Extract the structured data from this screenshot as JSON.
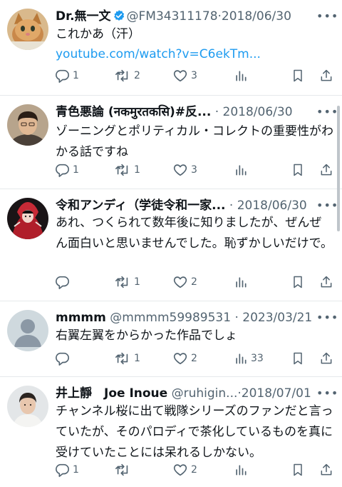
{
  "colors": {
    "link": "#1d9bf0",
    "verified": "#1d9bf0",
    "meta": "#536471",
    "text": "#0f1419"
  },
  "tweets": [
    {
      "name": "Dr.無一文",
      "verified": true,
      "handle": "@FM34311178",
      "date": "2018/06/30",
      "text": "これかあ（汗）",
      "link": "youtube.com/watch?v=C6ekTm...",
      "avatar": "cat-avatar",
      "replies": "1",
      "retweets": "2",
      "likes": "3",
      "views": ""
    },
    {
      "name": "青色悪論 (नकमुरतकसि)#反...",
      "verified": false,
      "handle": "",
      "date": "2018/06/30",
      "text": "ゾーニングとポリティカル・コレクトの重要性がわかる話ですね",
      "avatar": "man-portrait-avatar",
      "replies": "1",
      "retweets": "1",
      "likes": "3",
      "views": ""
    },
    {
      "name": "令和アンディ（学徒令和一家...",
      "verified": false,
      "handle": "",
      "date": "2018/06/30",
      "text": "あれ、つくられて数年後に知りましたが、ぜんぜん面白いと思いませんでした。恥ずかしいだけで。",
      "avatar": "red-character-avatar",
      "replies": "",
      "retweets": "1",
      "likes": "2",
      "views": ""
    },
    {
      "name": "mmmm",
      "verified": false,
      "handle": "@mmmm59989531",
      "date": "2023/03/21",
      "text": "右翼左翼をからかった作品でしょ",
      "avatar": "default-avatar",
      "replies": "",
      "retweets": "1",
      "likes": "2",
      "views": "33"
    },
    {
      "name": "井上靜　Joe Inoue",
      "verified": false,
      "handle": "@ruhigin...",
      "date": "2018/07/01",
      "text": "チャンネル桜に出て戦隊シリーズのファンだと言っていたが、そのパロディで茶化しているものを真に受けていたことには呆れるしかない。",
      "avatar": "woman-portrait-avatar",
      "replies": "1",
      "retweets": "",
      "likes": "2",
      "views": ""
    }
  ]
}
